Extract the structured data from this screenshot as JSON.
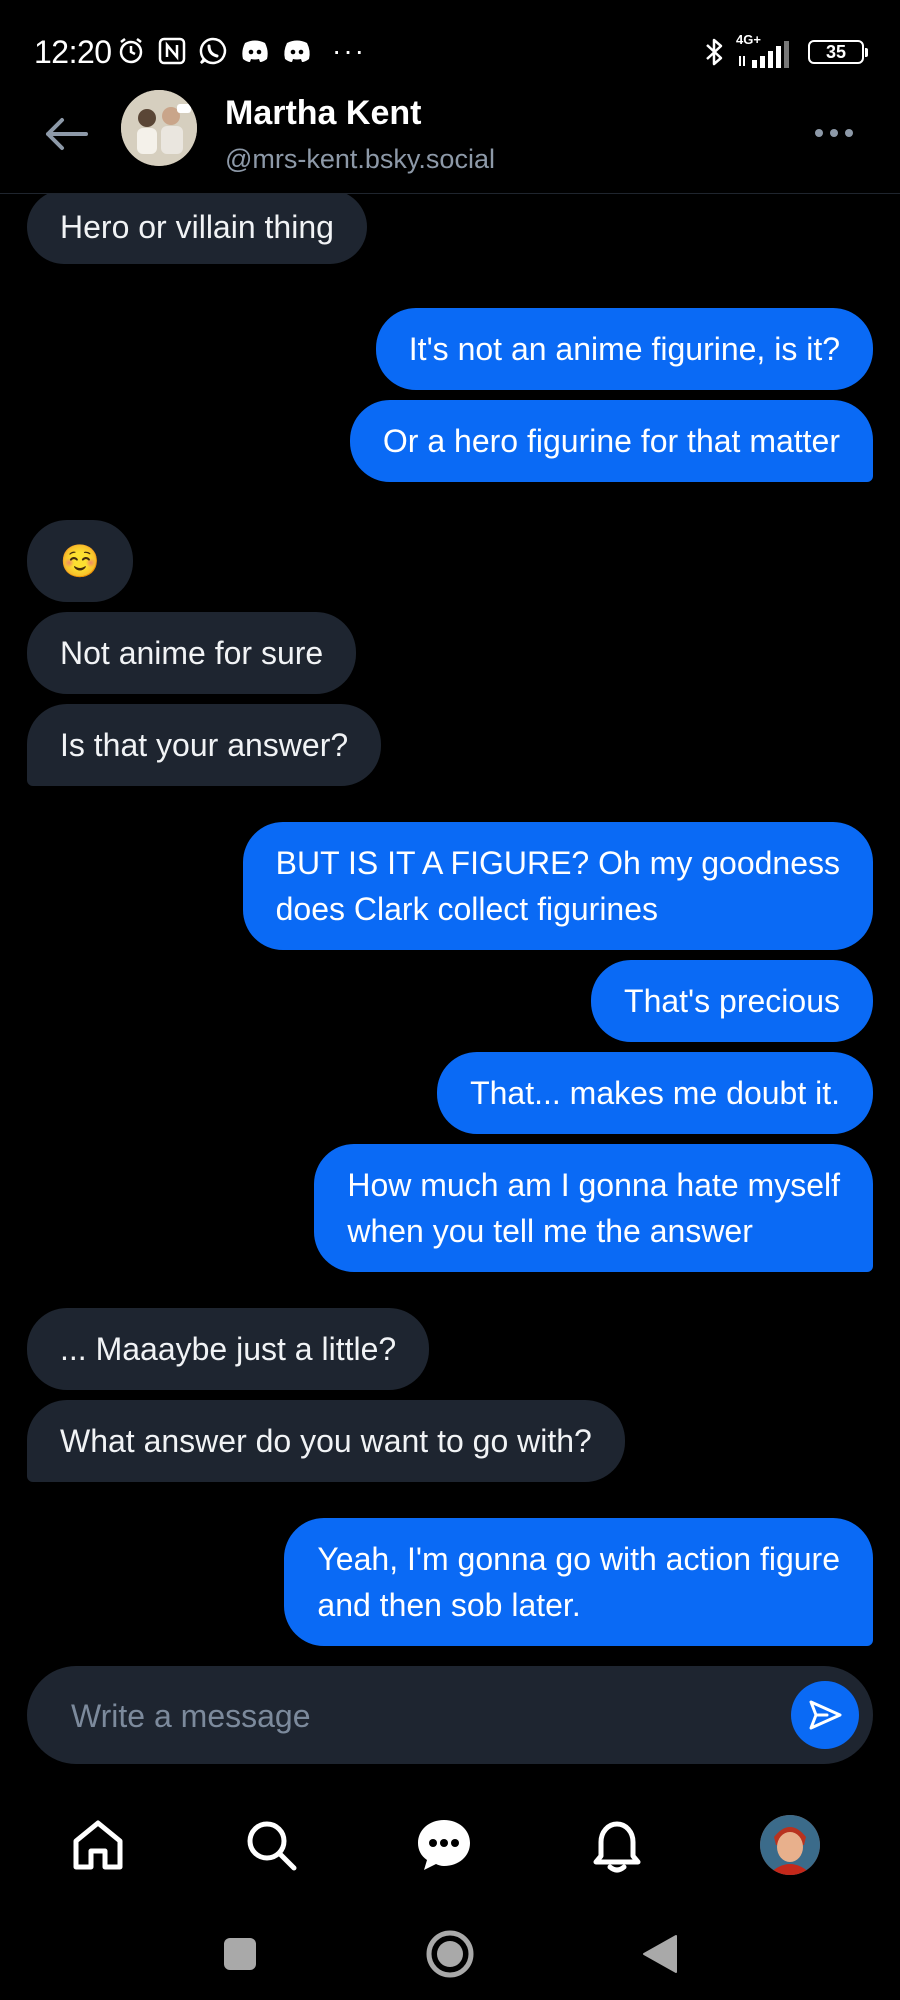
{
  "status_bar": {
    "time": "12:20",
    "network_label": "4G+",
    "battery_level": "35",
    "left_icons": [
      "alarm-icon",
      "nfc-icon",
      "whatsapp-icon",
      "discord-icon",
      "discord-icon"
    ],
    "more_indicator": "···"
  },
  "header": {
    "name": "Martha Kent",
    "handle": "@mrs-kent.bsky.social"
  },
  "messages": [
    {
      "side": "in",
      "text": "Hero or villain thing"
    },
    {
      "side": "out",
      "text": "It's not an anime figurine, is it?"
    },
    {
      "side": "out",
      "text": "Or a hero figurine for that matter"
    },
    {
      "side": "in",
      "text": "☺️"
    },
    {
      "side": "in",
      "text": "Not anime for sure"
    },
    {
      "side": "in",
      "text": "Is that your answer?"
    },
    {
      "side": "out",
      "text": "BUT IS IT A FIGURE? Oh my goodness\ndoes Clark collect figurines"
    },
    {
      "side": "out",
      "text": "That's precious"
    },
    {
      "side": "out",
      "text": "That... makes me doubt it."
    },
    {
      "side": "out",
      "text": "How much am I gonna hate myself\nwhen you tell me the answer"
    },
    {
      "side": "in",
      "text": "... Maaaybe just a little?"
    },
    {
      "side": "in",
      "text": "What answer do you want to go with?"
    },
    {
      "side": "out",
      "text": "Yeah, I'm gonna go with action figure\nand then sob later."
    }
  ],
  "composer": {
    "placeholder": "Write a message"
  },
  "bottom_nav": {
    "items": [
      "home-icon",
      "search-icon",
      "messages-icon",
      "notifications-icon",
      "profile-avatar"
    ]
  },
  "system_nav": {
    "items": [
      "recents-button",
      "home-button",
      "back-button"
    ]
  },
  "colors": {
    "background": "#000000",
    "incoming_bubble": "#1e2530",
    "outgoing_bubble": "#0a6af5",
    "handle_text": "#8d99a8",
    "placeholder_text": "#7c8a9c"
  }
}
